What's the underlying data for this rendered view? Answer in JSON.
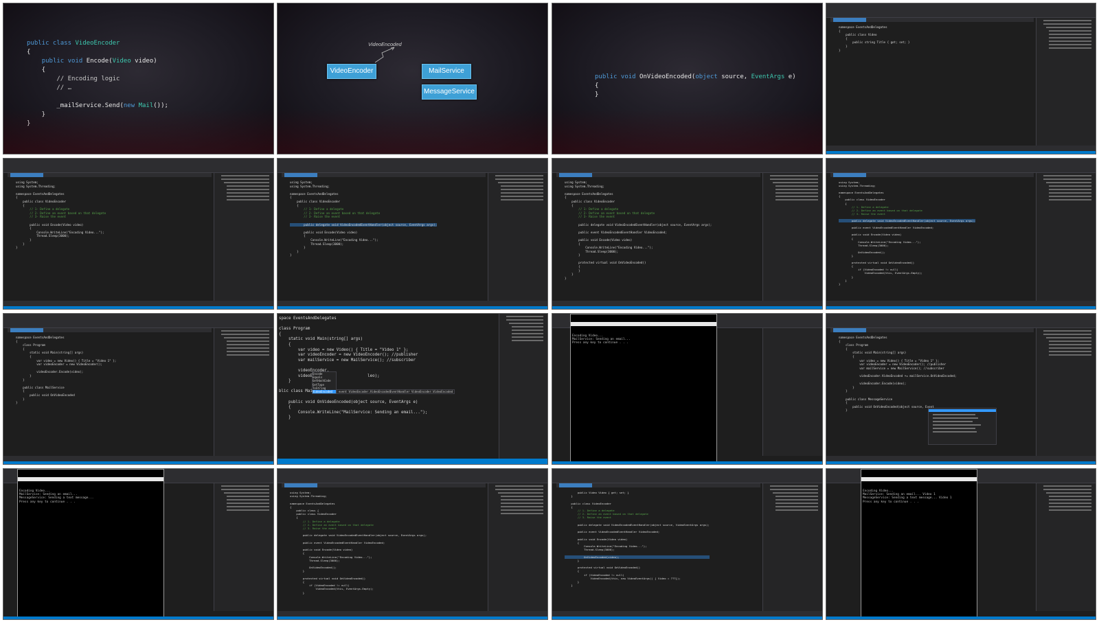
{
  "slide1": {
    "lines": [
      "public class VideoEncoder",
      "{",
      "    public void Encode(Video video)",
      "    {",
      "        // Encoding logic",
      "        // …",
      "",
      "        _mailService.Send(new Mail());",
      "    }",
      "}"
    ]
  },
  "slide2": {
    "arrow_label": "VideoEncoded",
    "boxes": [
      "VideoEncoder",
      "MailService",
      "MessageService"
    ]
  },
  "slide3": {
    "lines": [
      "public void OnVideoEncoded(object source, EventArgs e)",
      "{",
      "}"
    ]
  },
  "ide": {
    "t4_lines": [
      "namespace EventsAndDelegates",
      "{",
      "    public class Video",
      "    {",
      "        public string Title { get; set; }",
      "    }",
      "}"
    ],
    "t5_lines": [
      "using System;",
      "using System.Threading;",
      "",
      "namespace EventsAndDelegates",
      "{",
      "    public class VideoEncoder",
      "    {",
      "        // 1- Define a delegate",
      "        // 2- Define an event based on that delegate",
      "        // 3- Raise the event",
      "",
      "        public void Encode(Video video)",
      "        {",
      "            Console.WriteLine(\"Encoding Video...\");",
      "            Thread.Sleep(3000);",
      "        }",
      "    }",
      "}"
    ],
    "t6_lines": [
      "using System;",
      "using System.Threading;",
      "",
      "namespace EventsAndDelegates",
      "{",
      "    public class VideoEncoder",
      "    {",
      "        // 1- Define a delegate",
      "        // 2- Define an event based on that delegate",
      "        // 3- Raise the event",
      "",
      "        public delegate void VideoEncodedEventHandler(object source, EventArgs args);",
      "",
      "        public void Encode(Video video)",
      "        {",
      "            Console.WriteLine(\"Encoding Video...\");",
      "            Thread.Sleep(3000);",
      "        }",
      "    }",
      "}"
    ],
    "t7_lines": [
      "using System;",
      "using System.Threading;",
      "",
      "namespace EventsAndDelegates",
      "{",
      "    public class VideoEncoder",
      "    {",
      "        // 1- Define a delegate",
      "        // 2- Define an event based on that delegate",
      "        // 3- Raise the event",
      "",
      "        public delegate void VideoEncodedEventHandler(object source, EventArgs args);",
      "",
      "        public event VideoEncodedEventHandler VideoEncoded;",
      "",
      "        public void Encode(Video video)",
      "        {",
      "            Console.WriteLine(\"Encoding Video...\");",
      "            Thread.Sleep(3000);",
      "        }",
      "",
      "        protected virtual void OnVideoEncoded()",
      "        {",
      "        }",
      "    }",
      "}"
    ],
    "t8_lines": [
      "using System;",
      "using System.Threading;",
      "",
      "namespace EventsAndDelegates",
      "{",
      "    public class VideoEncoder",
      "    {",
      "        // 1- Define a delegate",
      "        // 2- Define an event based on that delegate",
      "        // 3- Raise the event",
      "",
      "        public delegate void VideoEncodedEventHandler(object source, EventArgs args);",
      "",
      "        public event VideoEncodedEventHandler VideoEncoded;",
      "",
      "        public void Encode(Video video)",
      "        {",
      "            Console.WriteLine(\"Encoding Video...\");",
      "            Thread.Sleep(3000);",
      "",
      "            OnVideoEncoded();",
      "        }",
      "",
      "        protected virtual void OnVideoEncoded()",
      "        {",
      "            if (VideoEncoded != null)",
      "                VideoEncoded(this, EventArgs.Empty);",
      "        }",
      "    }",
      "}"
    ],
    "t9_lines": [
      "namespace EventsAndDelegates",
      "{",
      "    class Program",
      "    {",
      "        static void Main(string[] args)",
      "        {",
      "            var video = new Video() { Title = \"Video 1\" };",
      "            var videoEncoder = new VideoEncoder();",
      "",
      "            videoEncoder.Encode(video);",
      "        }",
      "    }",
      "",
      "    public class MailService",
      "    {",
      "        public void OnVideoEncoded",
      "    }",
      "}"
    ],
    "t12_lines": [
      "namespace EventsAndDelegates",
      "{",
      "    class Program",
      "    {",
      "        static void Main(string[] args)",
      "        {",
      "            var video = new Video() { Title = \"Video 1\" };",
      "            var videoEncoder = new VideoEncoder(); //publisher",
      "            var mailService = new MailService(); //subscriber",
      "",
      "            videoEncoder.VideoEncoded += mailService.OnVideoEncoded;",
      "",
      "            videoEncoder.Encode(video);",
      "        }",
      "    }",
      "",
      "    public class MessageService",
      "    {",
      "        public void OnVideoEncoded(object source, Event",
      "    }"
    ],
    "t14_lines": [
      "using System;",
      "using System.Threading;",
      "",
      "namespace EventsAndDelegates",
      "{",
      "    public class {",
      "    public class VideoEncoder",
      "    {",
      "        // 1- Define a delegate",
      "        // 2- Define an event based on that delegate",
      "        // 3- Raise the event",
      "",
      "        public delegate void VideoEncodedEventHandler(object source, EventArgs args);",
      "",
      "        public event VideoEncodedEventHandler VideoEncoded;",
      "",
      "        public void Encode(Video video)",
      "        {",
      "            Console.WriteLine(\"Encoding Video...\");",
      "            Thread.Sleep(3000);",
      "",
      "            OnVideoEncoded();",
      "        }",
      "",
      "        protected virtual void OnVideoEncoded()",
      "        {",
      "            if (VideoEncoded != null)",
      "                VideoEncoded(this, EventArgs.Empty);",
      "        }"
    ],
    "t15_lines": [
      "        public Video Video { get; set; }",
      "    }",
      "",
      "    public class VideoEncoder",
      "    {",
      "        // 1- Define a delegate",
      "        // 2- Define an event based on that delegate",
      "        // 3- Raise the event",
      "",
      "        public delegate void VideoEncodedEventHandler(object source, VideoEventArgs args);",
      "",
      "        public event VideoEncodedEventHandler VideoEncoded;",
      "",
      "        public void Encode(Video video)",
      "        {",
      "            Console.WriteLine(\"Encoding Video...\");",
      "            Thread.Sleep(3000);",
      "",
      "            OnVideoEncoded(video);",
      "        }",
      "",
      "        protected virtual void OnVideoEncoded()",
      "        {",
      "            if (VideoEncoded != null)",
      "                VideoEncoded(this, new VideoEventArgs() { Video = ???});",
      "        }",
      "    }"
    ]
  },
  "zoom": {
    "lines": [
      "space EventsAndDelegates",
      "",
      "class Program",
      "{",
      "    static void Main(string[] args)",
      "    {",
      "        var video = new Video() { Title = \"Video 1\" };",
      "        var videoEncoder = new VideoEncoder(); //publisher",
      "        var mailService = new MailService(); //subscriber",
      "",
      "        videoEncoder.",
      "        videoEncode                  leo);",
      "    }",
      "",
      "blic class MailS",
      "",
      "    public void OnVideoEncoded(object source, EventArgs e)",
      "    {",
      "        Console.WriteLine(\"MailService: Sending an email...\");",
      "    }"
    ],
    "popup": [
      "Encode",
      "Equals",
      "GetHashCode",
      "GetType",
      "ToString",
      "VideoEncoded"
    ],
    "popup_hint": "event VideoEncoder.VideoEncodedEventHandler VideoEncoder.VideoEncoded"
  },
  "consoles": {
    "c11": [
      "Encoding Video...",
      "MailService: Sending an email...",
      "Press any key to continue . . ."
    ],
    "c13": [
      "Encoding Video...",
      "MailService: Sending an email...",
      "MessageService: Sending a text message...",
      "Press any key to continue . . ."
    ],
    "c16": [
      "Encoding Video...",
      "MailService: Sending an email... Video 1",
      "MessageService: Sending a text message... Video 1",
      "Press any key to continue . . ."
    ]
  }
}
